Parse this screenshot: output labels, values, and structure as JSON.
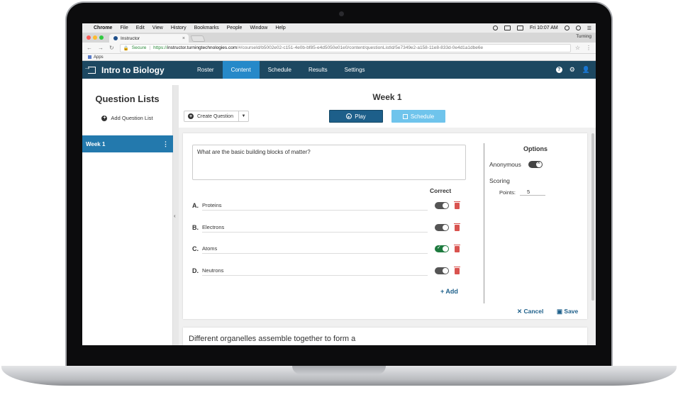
{
  "mac_menu": {
    "items": [
      "Chrome",
      "File",
      "Edit",
      "View",
      "History",
      "Bookmarks",
      "People",
      "Window",
      "Help"
    ],
    "clock": "Fri 10:07 AM"
  },
  "browser": {
    "tab_title": "Instructor",
    "profile": "Turning",
    "secure_label": "Secure",
    "url_https": "https://",
    "url_host": "instructor.turningtechnologies.com",
    "url_rest": "/#/courseId/b5002e02-c151-4e0b-bf85-e4d5050e01e0/content/questionListId/5e7349e2-a158-11e8-833d-0e4d1a1dbe6e",
    "bookmarks_label": "Apps"
  },
  "app": {
    "course_title": "Intro to Biology",
    "nav": [
      "Roster",
      "Content",
      "Schedule",
      "Results",
      "Settings"
    ],
    "active_nav": "Content"
  },
  "sidebar": {
    "title": "Question Lists",
    "add_label": "Add Question List",
    "items": [
      {
        "label": "Week 1"
      }
    ]
  },
  "main": {
    "title": "Week 1",
    "create_label": "Create Question",
    "play_label": "Play",
    "schedule_label": "Schedule"
  },
  "question": {
    "text": "What are the basic building blocks of matter?",
    "correct_header": "Correct",
    "answers": [
      {
        "letter": "A.",
        "text": "Proteins",
        "correct": false
      },
      {
        "letter": "B.",
        "text": "Electrons",
        "correct": false
      },
      {
        "letter": "C.",
        "text": "Atoms",
        "correct": true
      },
      {
        "letter": "D.",
        "text": "Neutrons",
        "correct": false
      }
    ],
    "add_label": "+ Add",
    "cancel_label": "✕ Cancel",
    "save_label": "Save"
  },
  "options": {
    "title": "Options",
    "anonymous_label": "Anonymous",
    "scoring_label": "Scoring",
    "points_label": "Points:",
    "points_value": "5"
  },
  "next_question": {
    "text": "Different organelles assemble together to form a"
  }
}
